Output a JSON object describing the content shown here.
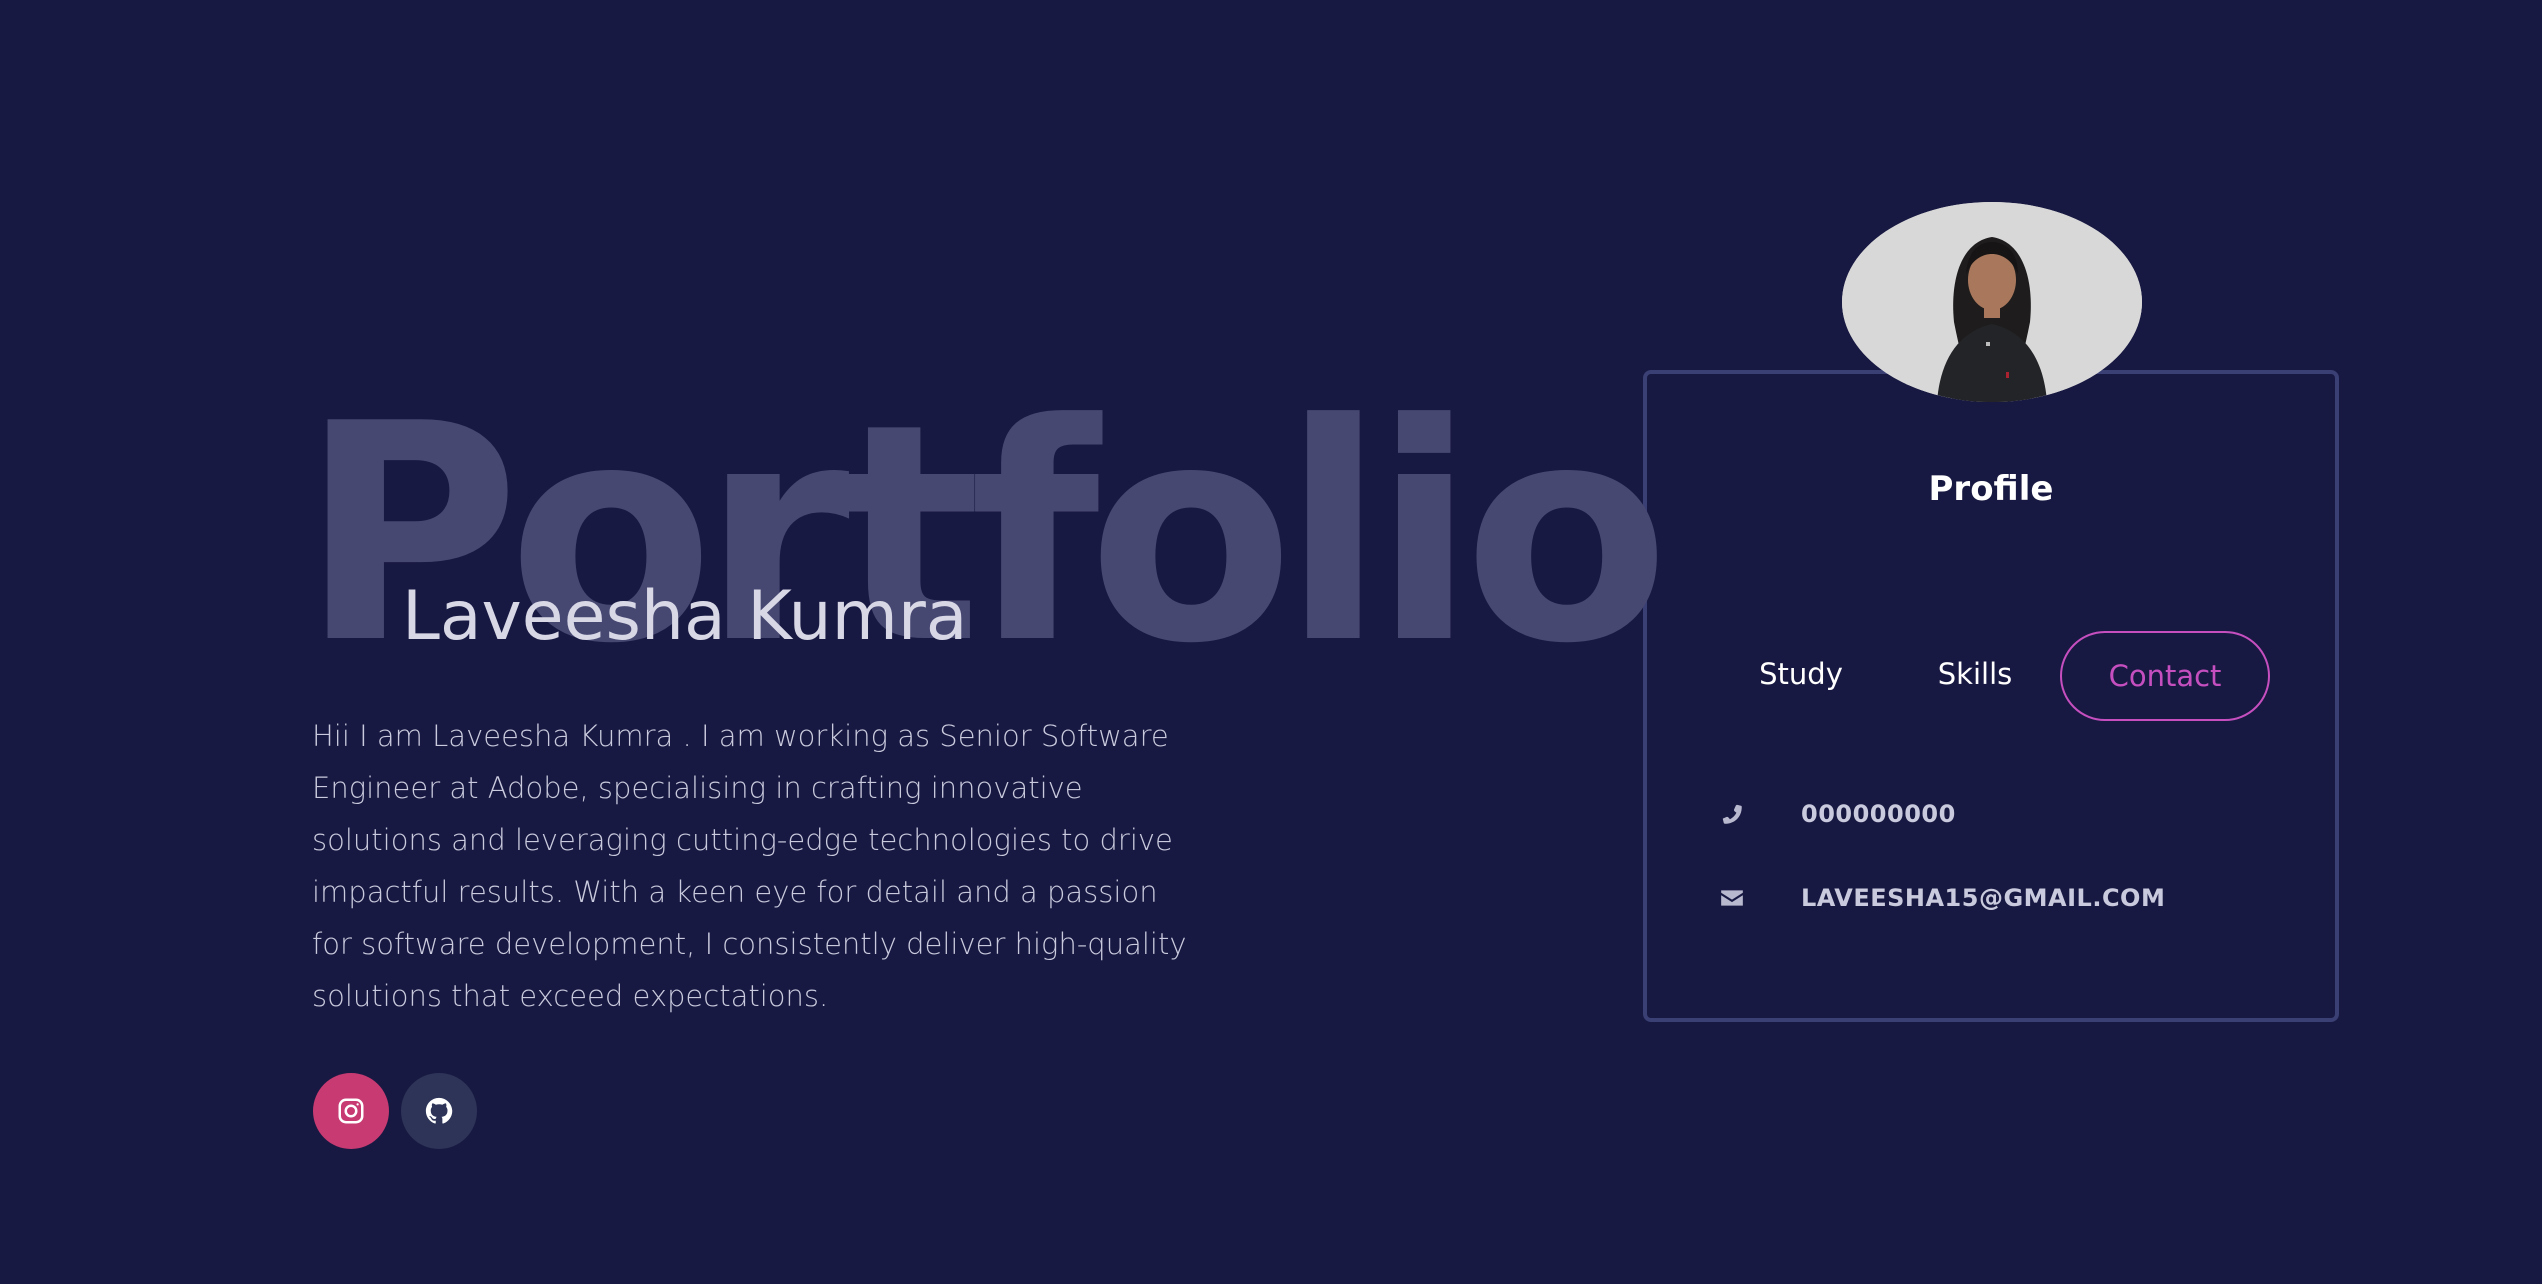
{
  "hero": {
    "background_word": "Portfolio",
    "name": "Laveesha Kumra",
    "bio": "Hii I am Laveesha Kumra . I am working as Senior Software Engineer at Adobe, specialising in crafting innovative solutions and leveraging cutting-edge technologies to drive impactful results. With a keen eye for detail and a passion for software development, I consistently deliver high-quality solutions that exceed expectations."
  },
  "socials": [
    {
      "name": "instagram",
      "icon": "instagram-icon",
      "color": "#c73a72"
    },
    {
      "name": "github",
      "icon": "github-icon",
      "color": "#2d3458"
    }
  ],
  "profile_card": {
    "title": "Profile",
    "avatar_icon": "profile-photo",
    "tabs": [
      {
        "label": "Study",
        "active": false
      },
      {
        "label": "Skills",
        "active": false
      },
      {
        "label": "Contact",
        "active": true
      }
    ],
    "contact": {
      "phone": {
        "icon": "phone-icon",
        "value": "000000000"
      },
      "email": {
        "icon": "envelope-icon",
        "value": "LAVEESHA15@GMAIL.COM"
      }
    }
  },
  "colors": {
    "background": "#181942",
    "accent": "#c64fc0",
    "card_border": "#3a3f74",
    "background_word": "#474872"
  }
}
